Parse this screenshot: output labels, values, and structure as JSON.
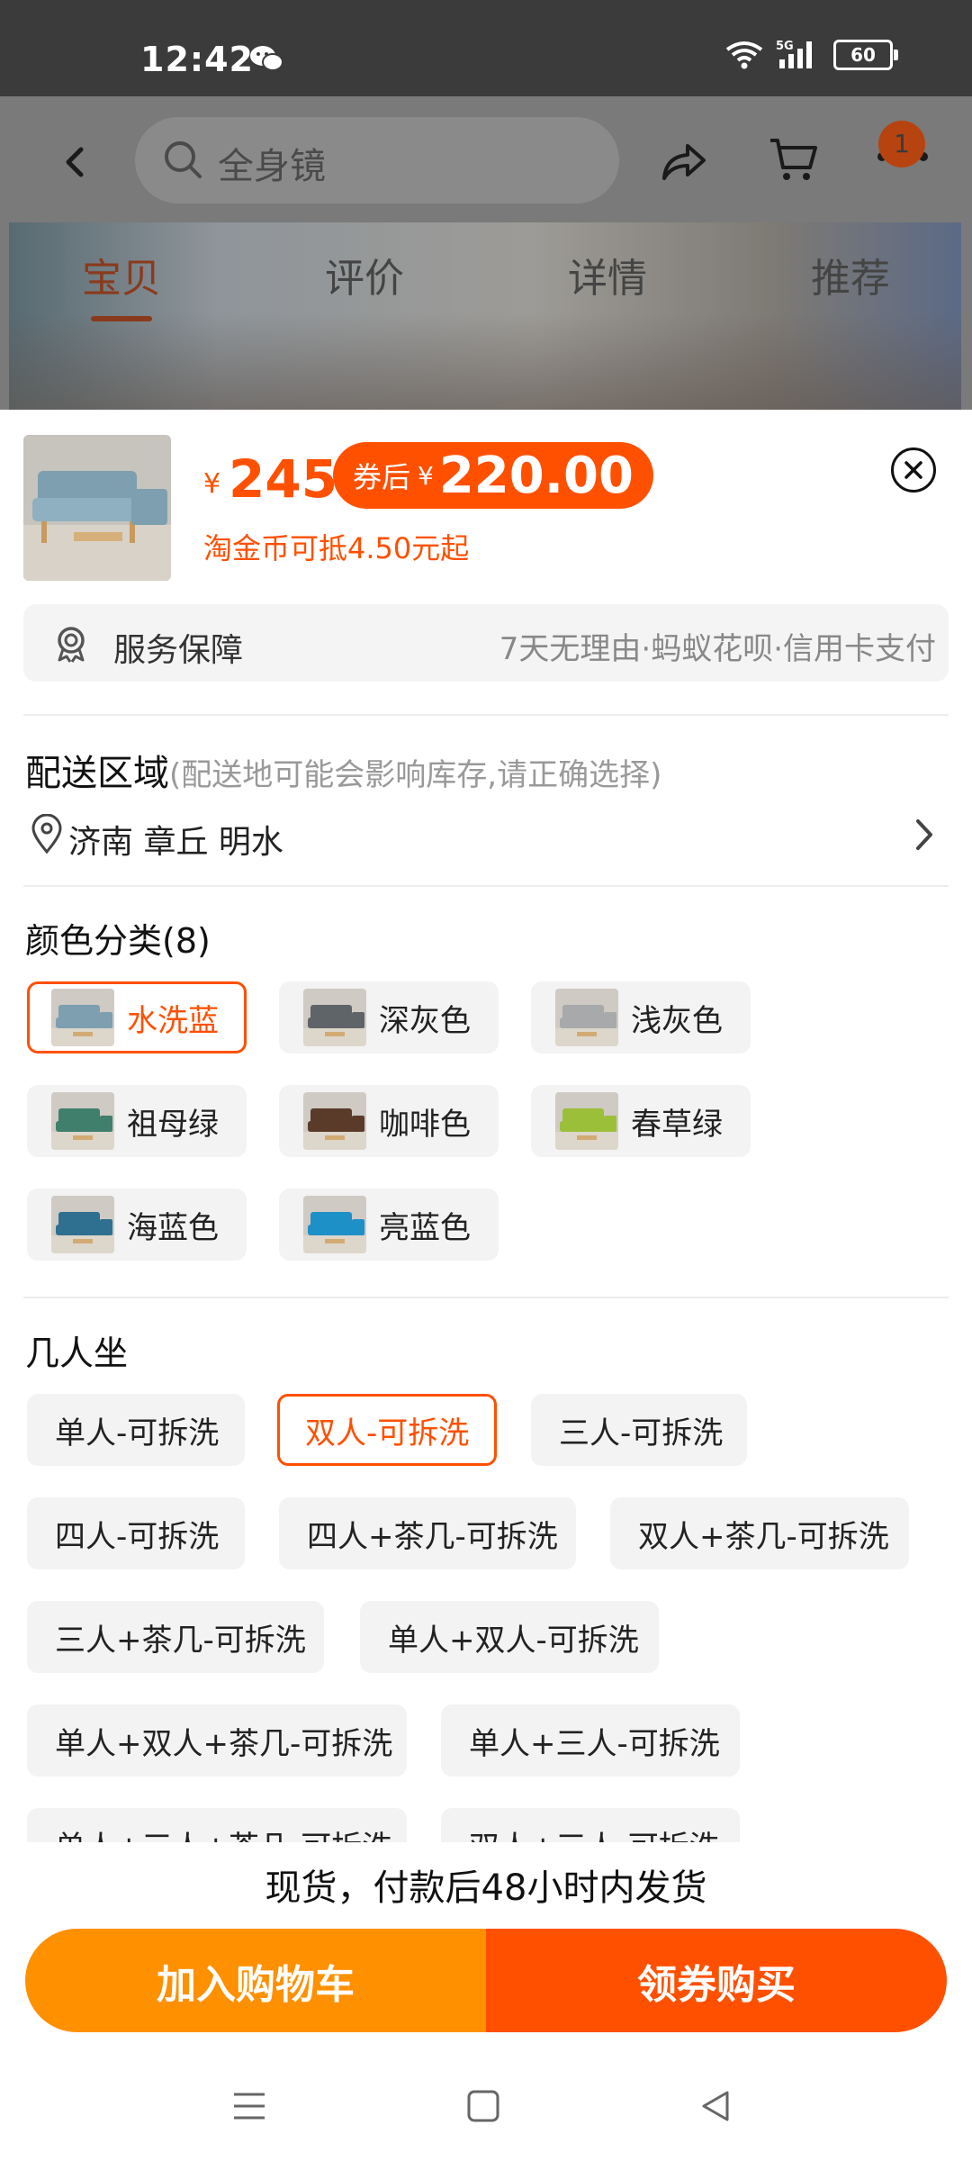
{
  "status": {
    "time": "12:42",
    "network": "5G",
    "battery": "60"
  },
  "header": {
    "search_placeholder": "全身镜",
    "cart_badge": "1",
    "tabs": [
      "宝贝",
      "评价",
      "详情",
      "推荐"
    ]
  },
  "product": {
    "price_currency": "¥",
    "price": "245",
    "coupon_label": "券后",
    "coupon_currency": "¥",
    "coupon_price": "220.00",
    "coin_text": "淘金币可抵4.50元起"
  },
  "service": {
    "label": "服务保障",
    "value": "7天无理由·蚂蚁花呗·信用卡支付"
  },
  "shipping": {
    "title": "配送区域",
    "hint": "(配送地可能会影响库存,请正确选择)",
    "location": "济南 章丘 明水"
  },
  "colors": {
    "title": "颜色分类(8)",
    "items": [
      {
        "label": "水洗蓝",
        "selected": true,
        "swatch": "#7d9fb0"
      },
      {
        "label": "深灰色",
        "selected": false,
        "swatch": "#5f6469"
      },
      {
        "label": "浅灰色",
        "selected": false,
        "swatch": "#a7a9ab"
      },
      {
        "label": "祖母绿",
        "selected": false,
        "swatch": "#3f7f6c"
      },
      {
        "label": "咖啡色",
        "selected": false,
        "swatch": "#5a3b2a"
      },
      {
        "label": "春草绿",
        "selected": false,
        "swatch": "#9cbf3a"
      },
      {
        "label": "海蓝色",
        "selected": false,
        "swatch": "#2f6f90"
      },
      {
        "label": "亮蓝色",
        "selected": false,
        "swatch": "#1d90c8"
      }
    ]
  },
  "seats": {
    "title": "几人坐",
    "items": [
      {
        "label": "单人-可拆洗",
        "selected": false
      },
      {
        "label": "双人-可拆洗",
        "selected": true
      },
      {
        "label": "三人-可拆洗",
        "selected": false
      },
      {
        "label": "四人-可拆洗",
        "selected": false
      },
      {
        "label": "四人+茶几-可拆洗",
        "selected": false
      },
      {
        "label": "双人+茶几-可拆洗",
        "selected": false
      },
      {
        "label": "三人+茶几-可拆洗",
        "selected": false
      },
      {
        "label": "单人+双人-可拆洗",
        "selected": false
      },
      {
        "label": "单人+双人+茶几-可拆洗",
        "selected": false
      },
      {
        "label": "单人+三人-可拆洗",
        "selected": false
      },
      {
        "label": "单人+三人+茶几-可拆洗",
        "selected": false
      },
      {
        "label": "双人+三人-可拆洗",
        "selected": false
      }
    ]
  },
  "footer": {
    "stock_note": "现货，付款后48小时内发货",
    "add_cart": "加入购物车",
    "buy": "领券购买"
  },
  "colors_theme": {
    "accent": "#ff5000",
    "secondary": "#ff9000"
  }
}
